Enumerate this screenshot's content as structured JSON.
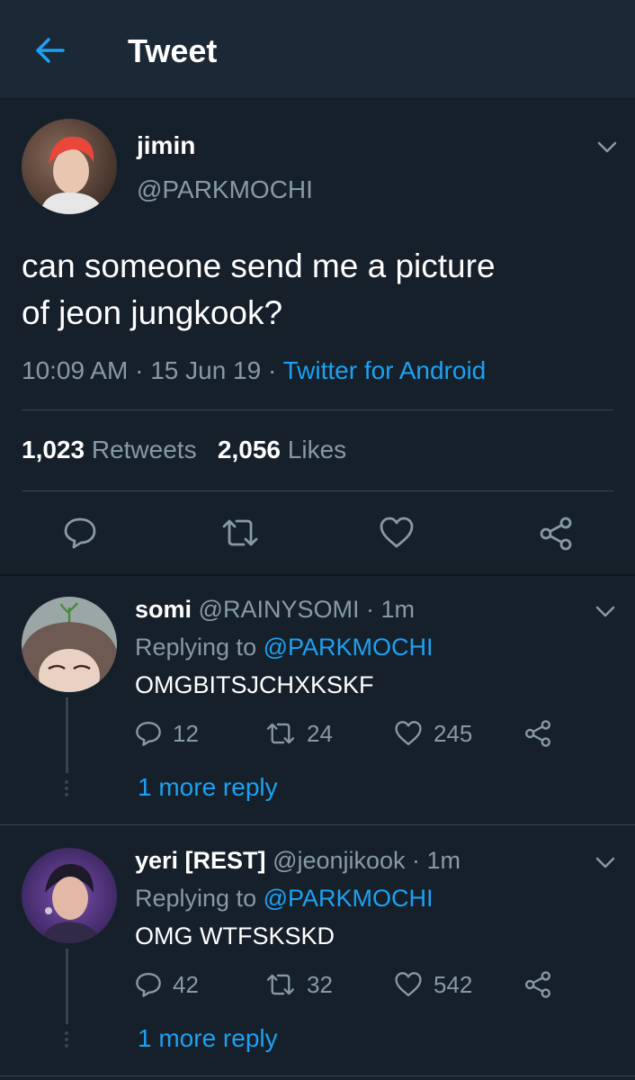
{
  "header": {
    "title": "Tweet",
    "back_icon": "arrow-left-icon"
  },
  "tweet": {
    "author_name": "jimin",
    "author_handle": "@PARKMOCHI",
    "text_line1": "can someone send me a picture",
    "text_line2": "of jeon jungkook?",
    "time": "10:09 AM",
    "date": "15 Jun 19",
    "separator": "·",
    "client": "Twitter for Android",
    "retweets_count": "1,023",
    "retweets_label": "Retweets",
    "likes_count": "2,056",
    "likes_label": "Likes"
  },
  "replies": [
    {
      "name": "somi",
      "handle": "@RAINYSOMI · 1m",
      "replying_prefix": "Replying to",
      "replying_to": "@PARKMOCHI",
      "text": "OMGBITSJCHXKSKF",
      "reply_count": "12",
      "retweet_count": "24",
      "like_count": "245",
      "more_reply": "1 more reply"
    },
    {
      "name": "yeri [REST]",
      "handle": "@jeonjikook · 1m",
      "replying_prefix": "Replying to",
      "replying_to": "@PARKMOCHI",
      "text": "OMG WTFSKSKD",
      "reply_count": "42",
      "retweet_count": "32",
      "like_count": "542",
      "more_reply": "1 more reply"
    }
  ],
  "colors": {
    "background": "#15202b",
    "header": "#1b2836",
    "accent": "#1da1f2",
    "muted": "#8899a6",
    "divider": "#38444d"
  }
}
